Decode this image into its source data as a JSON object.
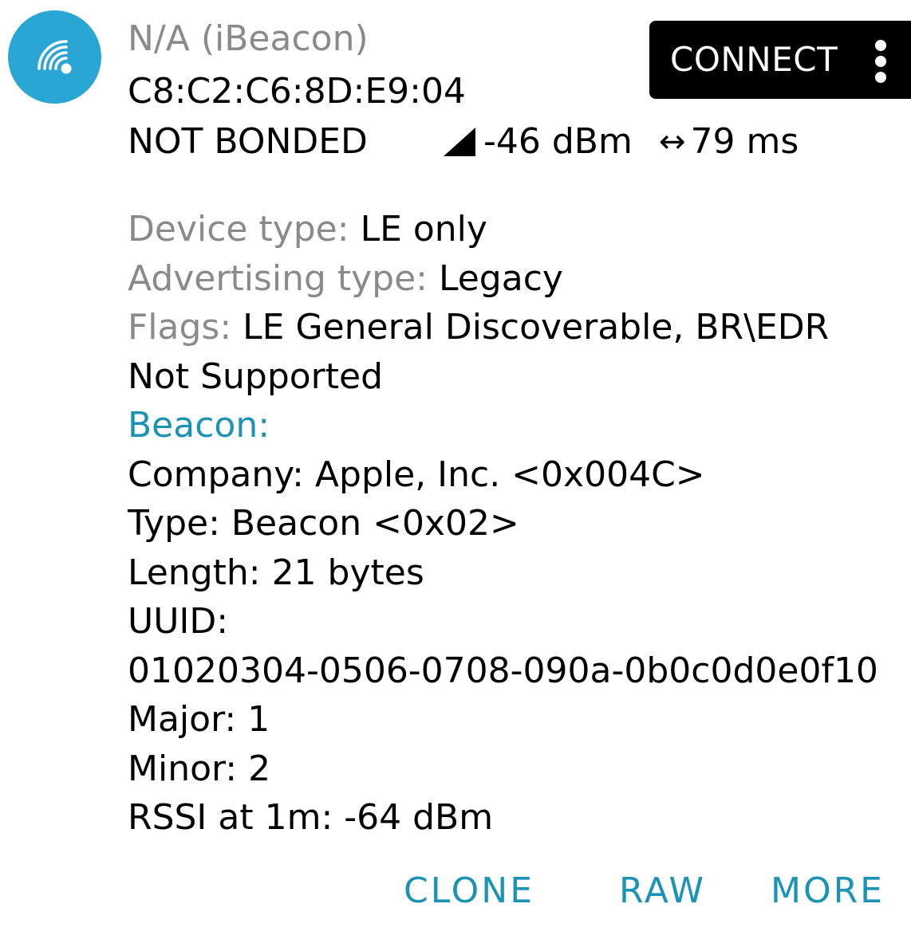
{
  "device": {
    "name": "N/A",
    "name_suffix": "(iBeacon)",
    "address": "C8:C2:C6:8D:E9:04",
    "bond_state": "NOT BONDED",
    "rssi": "-46 dBm",
    "interval": "79 ms",
    "icon": "wireless-beacon-icon",
    "accent_color": "#2aa6d5"
  },
  "toolbar": {
    "connect_label": "CONNECT",
    "overflow_icon": "more-vertical-icon"
  },
  "details": {
    "device_type_label": "Device type: ",
    "device_type_value": "LE only",
    "advertising_type_label": "Advertising type: ",
    "advertising_type_value": "Legacy",
    "flags_label": "Flags: ",
    "flags_value": "LE General Discoverable, BR\\EDR Not Supported",
    "beacon_heading": "Beacon:",
    "beacon_lines": [
      "Company: Apple, Inc. <0x004C>",
      "Type: Beacon <0x02>",
      "Length: 21 bytes",
      "UUID:",
      "01020304-0506-0708-090a-0b0c0d0e0f10",
      "Major: 1",
      "Minor: 2",
      "RSSI at 1m: -64 dBm"
    ]
  },
  "actions": {
    "clone": "CLONE",
    "raw": "RAW",
    "more": "MORE"
  },
  "colors": {
    "accent_text": "#1a93b5",
    "muted_text": "#8a8a8a",
    "button_bg": "#000000"
  }
}
